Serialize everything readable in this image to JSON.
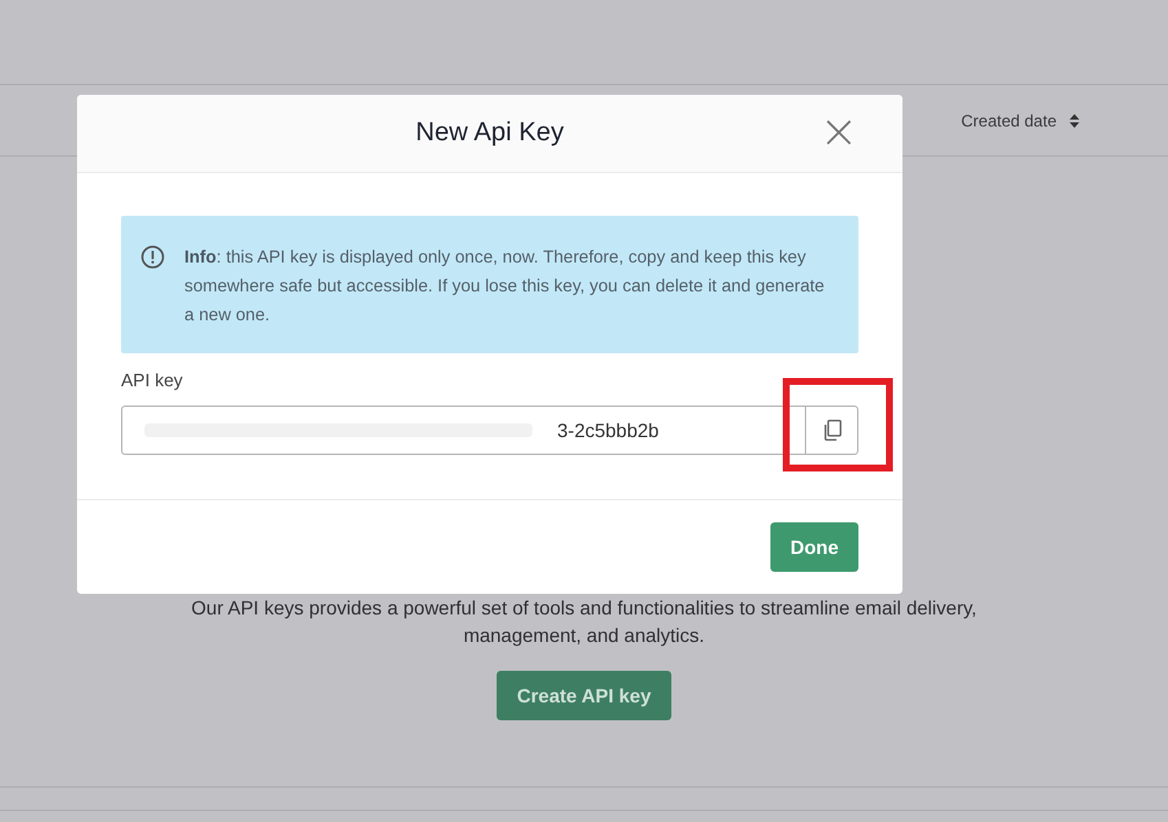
{
  "table": {
    "columns": [
      {
        "label": "Created date",
        "sortable": true
      }
    ]
  },
  "empty_state": {
    "description": "Our API keys provides a powerful set of tools and functionalities to streamline email delivery, management, and analytics.",
    "button": "Create API key"
  },
  "modal": {
    "title": "New Api Key",
    "close": "×",
    "info": "**Info**: this API key is displayed only once, now. Therefore, copy and keep this key somewhere safe but accessible. If you lose this key, you can delete it and generate a new one.",
    "key_label": "API key",
    "key_value": "3-2c5bbb2b",
    "key_redacted": true,
    "copy_highlighted": true,
    "button": "Done"
  }
}
